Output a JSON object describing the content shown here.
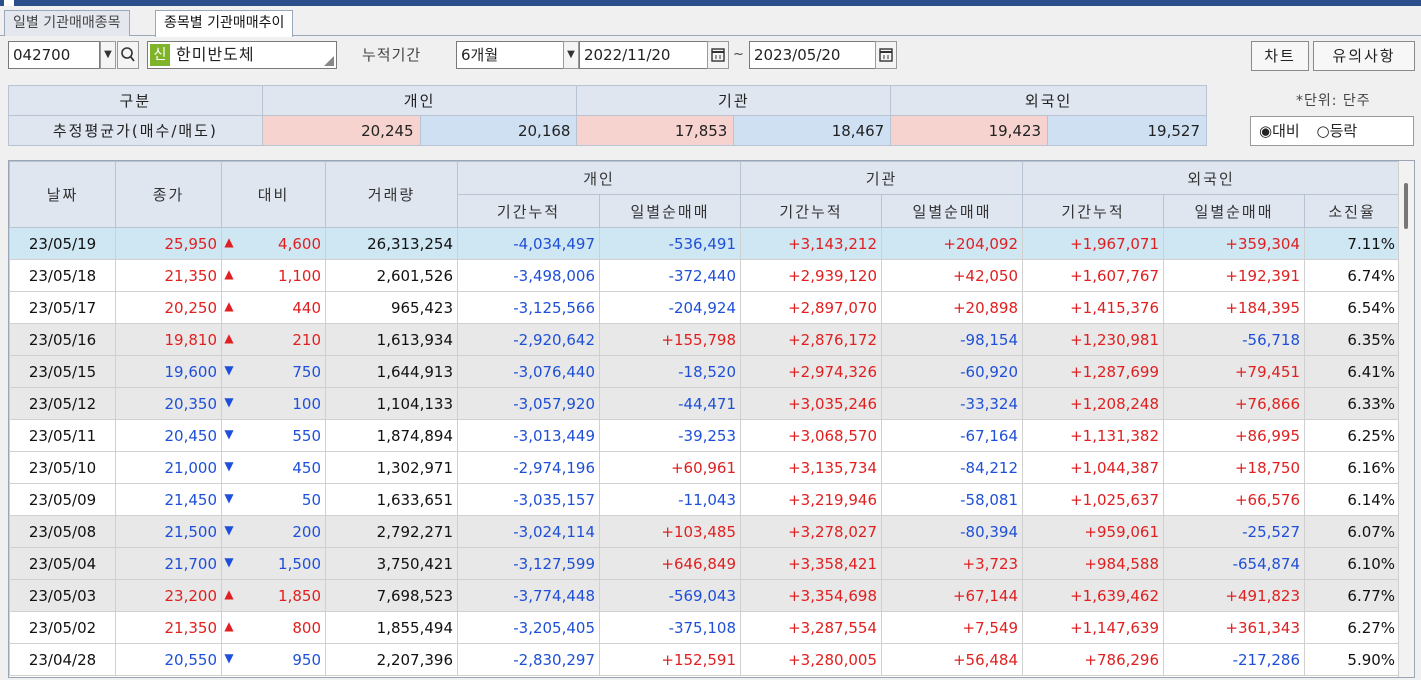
{
  "tabs": [
    "일별 기관매매종목",
    "종목별 기관매매추이"
  ],
  "stock": {
    "code": "042700",
    "badge": "신",
    "name": "한미반도체"
  },
  "period": {
    "label": "누적기간",
    "value": "6개월",
    "from": "2022/11/20",
    "tilde": "~",
    "to": "2023/05/20"
  },
  "buttons": {
    "chart": "차트",
    "notice": "유의사항"
  },
  "unit_text": "*단위: 단주",
  "radio": {
    "opt1": "◉대비",
    "opt2": "○등락"
  },
  "summary": {
    "header": [
      "구분",
      "개인",
      "기관",
      "외국인"
    ],
    "row_label": "추정평균가(매수/매도)",
    "values": [
      "20,245",
      "20,168",
      "17,853",
      "18,467",
      "19,423",
      "19,527"
    ]
  },
  "grid_headers": {
    "date": "날짜",
    "close": "종가",
    "diff": "대비",
    "volume": "거래량",
    "indiv": "개인",
    "inst": "기관",
    "foreign": "외국인",
    "cum": "기간누적",
    "daily": "일별순매매",
    "ratio": "소진율"
  },
  "rows": [
    {
      "date": "23/05/19",
      "close": "25,950",
      "dir": "up",
      "diff": "4,600",
      "vol": "26,313,254",
      "i_cum": "-4,034,497",
      "i_day": "-536,491",
      "n_cum": "+3,143,212",
      "n_day": "+204,092",
      "f_cum": "+1,967,071",
      "f_day": "+359,304",
      "ratio": "7.11%"
    },
    {
      "date": "23/05/18",
      "close": "21,350",
      "dir": "up",
      "diff": "1,100",
      "vol": "2,601,526",
      "i_cum": "-3,498,006",
      "i_day": "-372,440",
      "n_cum": "+2,939,120",
      "n_day": "+42,050",
      "f_cum": "+1,607,767",
      "f_day": "+192,391",
      "ratio": "6.74%"
    },
    {
      "date": "23/05/17",
      "close": "20,250",
      "dir": "up",
      "diff": "440",
      "vol": "965,423",
      "i_cum": "-3,125,566",
      "i_day": "-204,924",
      "n_cum": "+2,897,070",
      "n_day": "+20,898",
      "f_cum": "+1,415,376",
      "f_day": "+184,395",
      "ratio": "6.54%"
    },
    {
      "date": "23/05/16",
      "close": "19,810",
      "dir": "up",
      "diff": "210",
      "vol": "1,613,934",
      "i_cum": "-2,920,642",
      "i_day": "+155,798",
      "n_cum": "+2,876,172",
      "n_day": "-98,154",
      "f_cum": "+1,230,981",
      "f_day": "-56,718",
      "ratio": "6.35%"
    },
    {
      "date": "23/05/15",
      "close": "19,600",
      "dir": "down",
      "diff": "750",
      "vol": "1,644,913",
      "i_cum": "-3,076,440",
      "i_day": "-18,520",
      "n_cum": "+2,974,326",
      "n_day": "-60,920",
      "f_cum": "+1,287,699",
      "f_day": "+79,451",
      "ratio": "6.41%"
    },
    {
      "date": "23/05/12",
      "close": "20,350",
      "dir": "down",
      "diff": "100",
      "vol": "1,104,133",
      "i_cum": "-3,057,920",
      "i_day": "-44,471",
      "n_cum": "+3,035,246",
      "n_day": "-33,324",
      "f_cum": "+1,208,248",
      "f_day": "+76,866",
      "ratio": "6.33%"
    },
    {
      "date": "23/05/11",
      "close": "20,450",
      "dir": "down",
      "diff": "550",
      "vol": "1,874,894",
      "i_cum": "-3,013,449",
      "i_day": "-39,253",
      "n_cum": "+3,068,570",
      "n_day": "-67,164",
      "f_cum": "+1,131,382",
      "f_day": "+86,995",
      "ratio": "6.25%"
    },
    {
      "date": "23/05/10",
      "close": "21,000",
      "dir": "down",
      "diff": "450",
      "vol": "1,302,971",
      "i_cum": "-2,974,196",
      "i_day": "+60,961",
      "n_cum": "+3,135,734",
      "n_day": "-84,212",
      "f_cum": "+1,044,387",
      "f_day": "+18,750",
      "ratio": "6.16%"
    },
    {
      "date": "23/05/09",
      "close": "21,450",
      "dir": "down",
      "diff": "50",
      "vol": "1,633,651",
      "i_cum": "-3,035,157",
      "i_day": "-11,043",
      "n_cum": "+3,219,946",
      "n_day": "-58,081",
      "f_cum": "+1,025,637",
      "f_day": "+66,576",
      "ratio": "6.14%"
    },
    {
      "date": "23/05/08",
      "close": "21,500",
      "dir": "down",
      "diff": "200",
      "vol": "2,792,271",
      "i_cum": "-3,024,114",
      "i_day": "+103,485",
      "n_cum": "+3,278,027",
      "n_day": "-80,394",
      "f_cum": "+959,061",
      "f_day": "-25,527",
      "ratio": "6.07%"
    },
    {
      "date": "23/05/04",
      "close": "21,700",
      "dir": "down",
      "diff": "1,500",
      "vol": "3,750,421",
      "i_cum": "-3,127,599",
      "i_day": "+646,849",
      "n_cum": "+3,358,421",
      "n_day": "+3,723",
      "f_cum": "+984,588",
      "f_day": "-654,874",
      "ratio": "6.10%"
    },
    {
      "date": "23/05/03",
      "close": "23,200",
      "dir": "up",
      "diff": "1,850",
      "vol": "7,698,523",
      "i_cum": "-3,774,448",
      "i_day": "-569,043",
      "n_cum": "+3,354,698",
      "n_day": "+67,144",
      "f_cum": "+1,639,462",
      "f_day": "+491,823",
      "ratio": "6.77%"
    },
    {
      "date": "23/05/02",
      "close": "21,350",
      "dir": "up",
      "diff": "800",
      "vol": "1,855,494",
      "i_cum": "-3,205,405",
      "i_day": "-375,108",
      "n_cum": "+3,287,554",
      "n_day": "+7,549",
      "f_cum": "+1,147,639",
      "f_day": "+361,343",
      "ratio": "6.27%"
    },
    {
      "date": "23/04/28",
      "close": "20,550",
      "dir": "down",
      "diff": "950",
      "vol": "2,207,396",
      "i_cum": "-2,830,297",
      "i_day": "+152,591",
      "n_cum": "+3,280,005",
      "n_day": "+56,484",
      "f_cum": "+786,296",
      "f_day": "-217,286",
      "ratio": "5.90%"
    }
  ],
  "row_shade": [
    "sel",
    "",
    "",
    "shade",
    "shade",
    "shade",
    "",
    "",
    "",
    "shade",
    "shade",
    "shade",
    "",
    ""
  ],
  "colors": {
    "up": "#e02020",
    "down": "#1f4fd8",
    "selected_row": "#cfe6f3",
    "shaded_row": "#e8e8e8",
    "title_bar": "#2b4f8a"
  }
}
